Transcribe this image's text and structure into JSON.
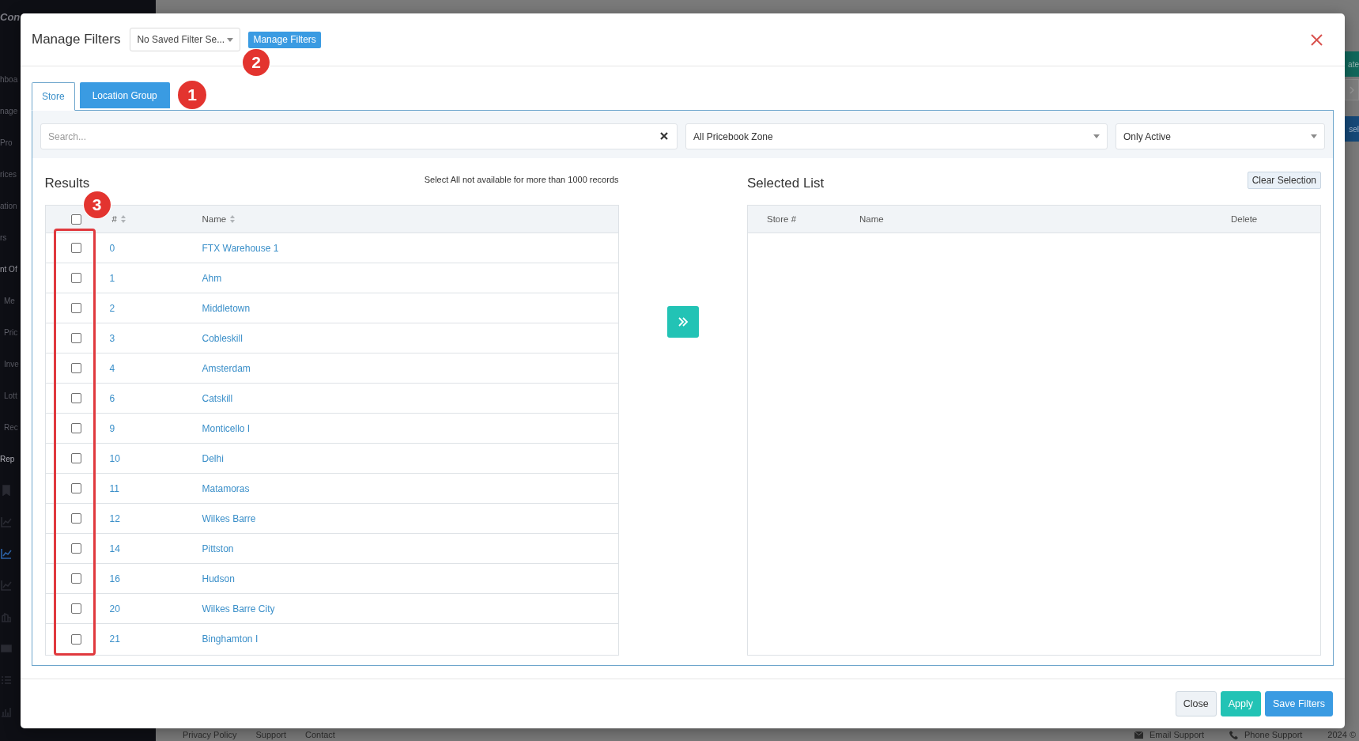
{
  "background": {
    "logo": "Con",
    "sidebar_items": [
      {
        "label": "hboa",
        "selected": false,
        "expanded": false
      },
      {
        "label": "nage",
        "selected": false,
        "expanded": false
      },
      {
        "label": "Pro",
        "selected": false,
        "expanded": false
      },
      {
        "label": "rices",
        "selected": false,
        "expanded": false
      },
      {
        "label": "ation",
        "selected": false,
        "expanded": false
      },
      {
        "label": "rs",
        "selected": false,
        "expanded": false
      },
      {
        "label": "nt Of",
        "selected": false,
        "expanded": true,
        "children": [
          {
            "label": "Me",
            "selected": false
          },
          {
            "label": "Pric",
            "selected": false
          },
          {
            "label": "Inve",
            "selected": false
          },
          {
            "label": "Lott",
            "selected": false
          },
          {
            "label": "Rec",
            "selected": false
          }
        ]
      },
      {
        "label": "Rep",
        "selected": true,
        "expanded": false
      }
    ],
    "sidebar_icons": [
      {
        "kind": "bookmark",
        "selected": false
      },
      {
        "kind": "line-chart",
        "selected": false
      },
      {
        "kind": "line-chart",
        "selected": true
      },
      {
        "kind": "line-chart",
        "selected": false
      },
      {
        "kind": "building",
        "selected": false
      },
      {
        "kind": "card",
        "selected": false
      },
      {
        "kind": "list",
        "selected": false
      },
      {
        "kind": "bar-chart",
        "selected": false
      }
    ],
    "side_buttons": [
      {
        "kind": "teal",
        "label": "ate"
      },
      {
        "kind": "arrow"
      },
      {
        "kind": "blue",
        "label": "sel"
      }
    ],
    "footer_links": [
      "Privacy Policy",
      "Support",
      "Contact"
    ],
    "footer_contacts": [
      {
        "kind": "email",
        "label": "Email Support"
      },
      {
        "kind": "phone",
        "label": "Phone Support"
      }
    ],
    "copyright": "2024 ©"
  },
  "modal": {
    "title": "Manage Filters",
    "saved_filter": {
      "value": "No Saved Filter Se..."
    },
    "manage_button": "Manage Filters",
    "callout": "2"
  },
  "tabs": [
    {
      "label": "Store",
      "selected": true
    },
    {
      "label": "Location Group",
      "selected": false
    }
  ],
  "tabs_callout": "1",
  "filters": {
    "search": {
      "placeholder": "Search..."
    },
    "zone": {
      "value": "All Pricebook Zone"
    },
    "status": {
      "value": "Only Active"
    }
  },
  "results": {
    "title": "Results",
    "note": "Select All not available for more than 1000 records",
    "callout": "3",
    "all_checked": false,
    "columns": [
      {
        "label": "#",
        "sortable": true
      },
      {
        "label": "Name",
        "sortable": true
      }
    ],
    "rows": [
      {
        "number": "0",
        "name": "FTX Warehouse 1",
        "checked": false
      },
      {
        "number": "1",
        "name": "Ahm",
        "checked": false
      },
      {
        "number": "2",
        "name": "Middletown",
        "checked": false
      },
      {
        "number": "3",
        "name": "Cobleskill",
        "checked": false
      },
      {
        "number": "4",
        "name": "Amsterdam",
        "checked": false
      },
      {
        "number": "6",
        "name": "Catskill",
        "checked": false
      },
      {
        "number": "9",
        "name": "Monticello I",
        "checked": false
      },
      {
        "number": "10",
        "name": "Delhi",
        "checked": false
      },
      {
        "number": "11",
        "name": "Matamoras",
        "checked": false
      },
      {
        "number": "12",
        "name": "Wilkes Barre",
        "checked": false
      },
      {
        "number": "14",
        "name": "Pittston",
        "checked": false
      },
      {
        "number": "16",
        "name": "Hudson",
        "checked": false
      },
      {
        "number": "20",
        "name": "Wilkes Barre City",
        "checked": false
      },
      {
        "number": "21",
        "name": "Binghamton I",
        "checked": false
      }
    ]
  },
  "selected_list": {
    "title": "Selected List",
    "clear_button": "Clear Selection",
    "columns": [
      "Store #",
      "Name",
      "Delete"
    ]
  },
  "footer_buttons": [
    {
      "kind": "default",
      "label": "Close"
    },
    {
      "kind": "teal",
      "label": "Apply"
    },
    {
      "kind": "primary",
      "label": "Save Filters"
    }
  ]
}
